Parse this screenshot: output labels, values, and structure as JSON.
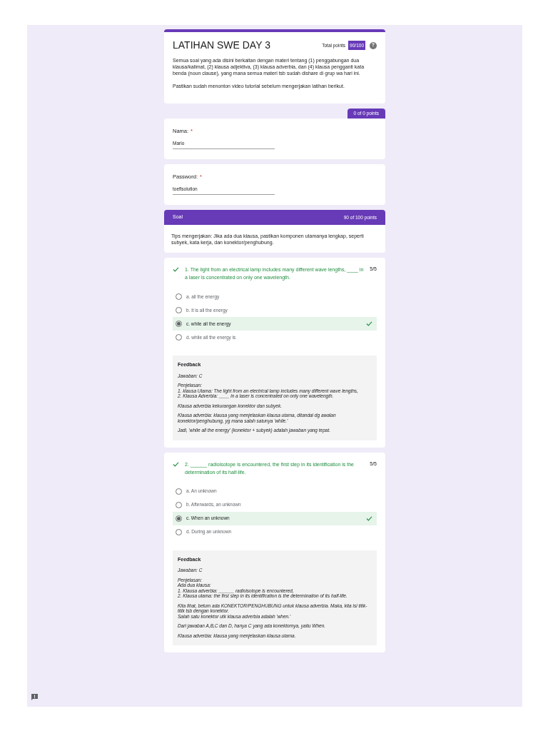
{
  "header": {
    "title": "LATIHAN SWE DAY 3",
    "total_points_label": "Total points",
    "score": "90/100",
    "help": "?",
    "paragraphs": [
      "Semua soal yang ada disini berkaitan dengan materi tentang (1) penggabungan dua klausa/kalimat, (2) klausa adjektiva, (3) klausa adverbia, dan (4) klausa pengganti kata benda (noun clause), yang mana semua materi tsb sudah dishare di grup wa hari ini.",
      "Pastikan sudah menonton video tutorial sebelum mengerjakan latihan berikut."
    ]
  },
  "section_1": {
    "points": "0 of 0 points",
    "fields": [
      {
        "label": "Nama:",
        "required_mark": "*",
        "value": "Mario"
      },
      {
        "label": "Password:",
        "required_mark": "*",
        "value": "toeflsolution"
      }
    ]
  },
  "section_2": {
    "title": "Soal",
    "points": "90 of 100 points",
    "description": "Tips mengerjakan: Jika ada dua klausa, pastikan komponen utamanya lengkap, seperti subyek, kata kerja, dan konektor/penghubung.",
    "questions": [
      {
        "text": "1. The light from an electrical lamp includes many different wave lengths, ____ in a laser is concentrated on only one wavelength.",
        "correct": true,
        "score": "5/5",
        "options": [
          {
            "label": "a. all the energy",
            "selected": false,
            "correct": false
          },
          {
            "label": "b. it is all the energy",
            "selected": false,
            "correct": false
          },
          {
            "label": "c. while all the energy",
            "selected": true,
            "correct": true
          },
          {
            "label": "d. while all the energy is",
            "selected": false,
            "correct": false
          }
        ],
        "feedback": {
          "heading": "Feedback",
          "paragraphs": [
            [
              "Jawaban: C"
            ],
            [
              "Penjelasan:",
              "1. klausa Utama: The light from an electrical lamp includes many different wave lengths,",
              "2. Klausa Adverbia: ____ in a laser is concentrated on only one wavelength."
            ],
            [
              "Klausa adverbia kekurangan konektor dan subyek."
            ],
            [
              "Klausa adverbia: klausa yang menjelaskan klausa utama, ditandai dg awalan konektor/penghubung, yg mana salah satunya 'while.'"
            ],
            [
              "Jadi, 'while all the energy' (konektor + subyek) adalah jawaban yang tepat."
            ]
          ]
        }
      },
      {
        "text": "2. ______ radioisotope is encountered, the first step in its identification is the determination of its half-life.",
        "correct": true,
        "score": "5/5",
        "options": [
          {
            "label": "a. An unknown",
            "selected": false,
            "correct": false
          },
          {
            "label": "b. Afterwards, an unknown",
            "selected": false,
            "correct": false
          },
          {
            "label": "c. When an unknown",
            "selected": true,
            "correct": true
          },
          {
            "label": "d. During an unknown",
            "selected": false,
            "correct": false
          }
        ],
        "feedback": {
          "heading": "Feedback",
          "paragraphs": [
            [
              "Jawaban: C"
            ],
            [
              "Penjelasan:",
              "Ada dua klausa:",
              "1. Klausa adverbia: ______ radioisotope is encountered,",
              "2. Klausa utama: the first step in its identification is the determination of its half-life."
            ],
            [
              "Kita lihat, belum ada KONEKTOR/PENGHUBUNG untuk klausa adverbia. Maka, kita isi titik-titik tsb dengan konektor.",
              "Salah satu konektor utk klausa adverbia adalah 'when.'"
            ],
            [
              "Dari jawaban A,B,C dan D, hanya C yang ada konektornya, yaitu When."
            ],
            [
              "Klausa adverbia: klausa yang menjelaskan klausa utama."
            ]
          ]
        }
      }
    ]
  }
}
